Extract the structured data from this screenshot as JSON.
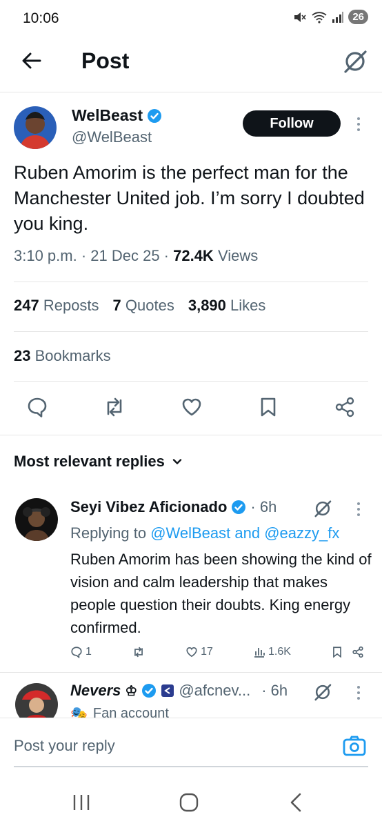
{
  "status_bar": {
    "time": "10:06",
    "battery": "26"
  },
  "header": {
    "title": "Post"
  },
  "tweet": {
    "author_name": "WelBeast",
    "author_handle": "@WelBeast",
    "follow_label": "Follow",
    "text": "Ruben Amorim is the perfect man for the Manchester United job. I’m sorry I doubted you king.",
    "time_date": "3:10 p.m. · 21 Dec 25 · ",
    "views_count": "72.4K",
    "views_label": " Views",
    "reposts_count": "247",
    "reposts_label": " Reposts",
    "quotes_count": "7",
    "quotes_label": " Quotes",
    "likes_count": "3,890",
    "likes_label": " Likes",
    "bookmarks_count": "23",
    "bookmarks_label": " Bookmarks"
  },
  "replies_sort": {
    "label": "Most relevant replies"
  },
  "reply1": {
    "name": "Seyi Vibez Aficionado",
    "time": "· 6h",
    "replying_prefix": "Replying to ",
    "replying_handles": "@WelBeast and @eazzy_fx",
    "text": "Ruben Amorim has been showing the kind of vision and calm leadership that makes people question their doubts. King energy confirmed.",
    "replies": "1",
    "likes": "17",
    "views": "1.6K"
  },
  "reply2": {
    "name": "Nevers",
    "handle": "@afcnev...",
    "time": "· 6h",
    "badge": "Fan account"
  },
  "reply_box": {
    "placeholder": "Post your reply"
  },
  "colors": {
    "accent": "#1d9bf0",
    "text": "#0f1419",
    "muted": "#536471"
  }
}
